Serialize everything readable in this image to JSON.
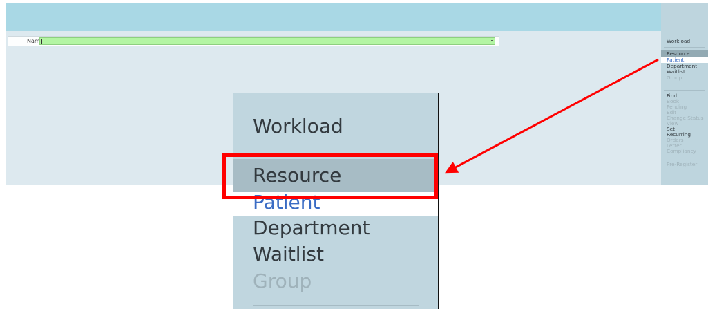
{
  "form": {
    "name_label": "Name",
    "name_value": "",
    "dropdown_glyph": "▾"
  },
  "sidebar": {
    "items": [
      {
        "label": "Workload",
        "state": "normal"
      },
      {
        "label": "Resource",
        "state": "selected"
      },
      {
        "label": "Patient",
        "state": "link"
      },
      {
        "label": "Department",
        "state": "normal"
      },
      {
        "label": "Waitlist",
        "state": "normal"
      },
      {
        "label": "Group",
        "state": "disabled"
      },
      {
        "label": "Find",
        "state": "normal"
      },
      {
        "label": "Book",
        "state": "disabled"
      },
      {
        "label": "Pending",
        "state": "disabled"
      },
      {
        "label": "Edit",
        "state": "disabled"
      },
      {
        "label": "Change Status",
        "state": "disabled"
      },
      {
        "label": "View",
        "state": "disabled"
      },
      {
        "label": "Set",
        "state": "normal"
      },
      {
        "label": "Recurring",
        "state": "normal"
      },
      {
        "label": "Orders",
        "state": "disabled"
      },
      {
        "label": "Letter",
        "state": "disabled"
      },
      {
        "label": "Compliancy",
        "state": "disabled"
      },
      {
        "label": "Pre-Register",
        "state": "disabled"
      }
    ]
  },
  "zoom": {
    "items": [
      {
        "label": "Workload"
      },
      {
        "label": "Resource"
      },
      {
        "label": "Patient"
      },
      {
        "label": "Department"
      },
      {
        "label": "Waitlist"
      },
      {
        "label": "Group"
      }
    ]
  },
  "colors": {
    "header": "#a9d8e5",
    "background": "#dde9ef",
    "sidebar": "#bed5de",
    "input_green": "#b3f5a3",
    "highlight": "#ff0000",
    "link_blue": "#3a6cc4"
  }
}
